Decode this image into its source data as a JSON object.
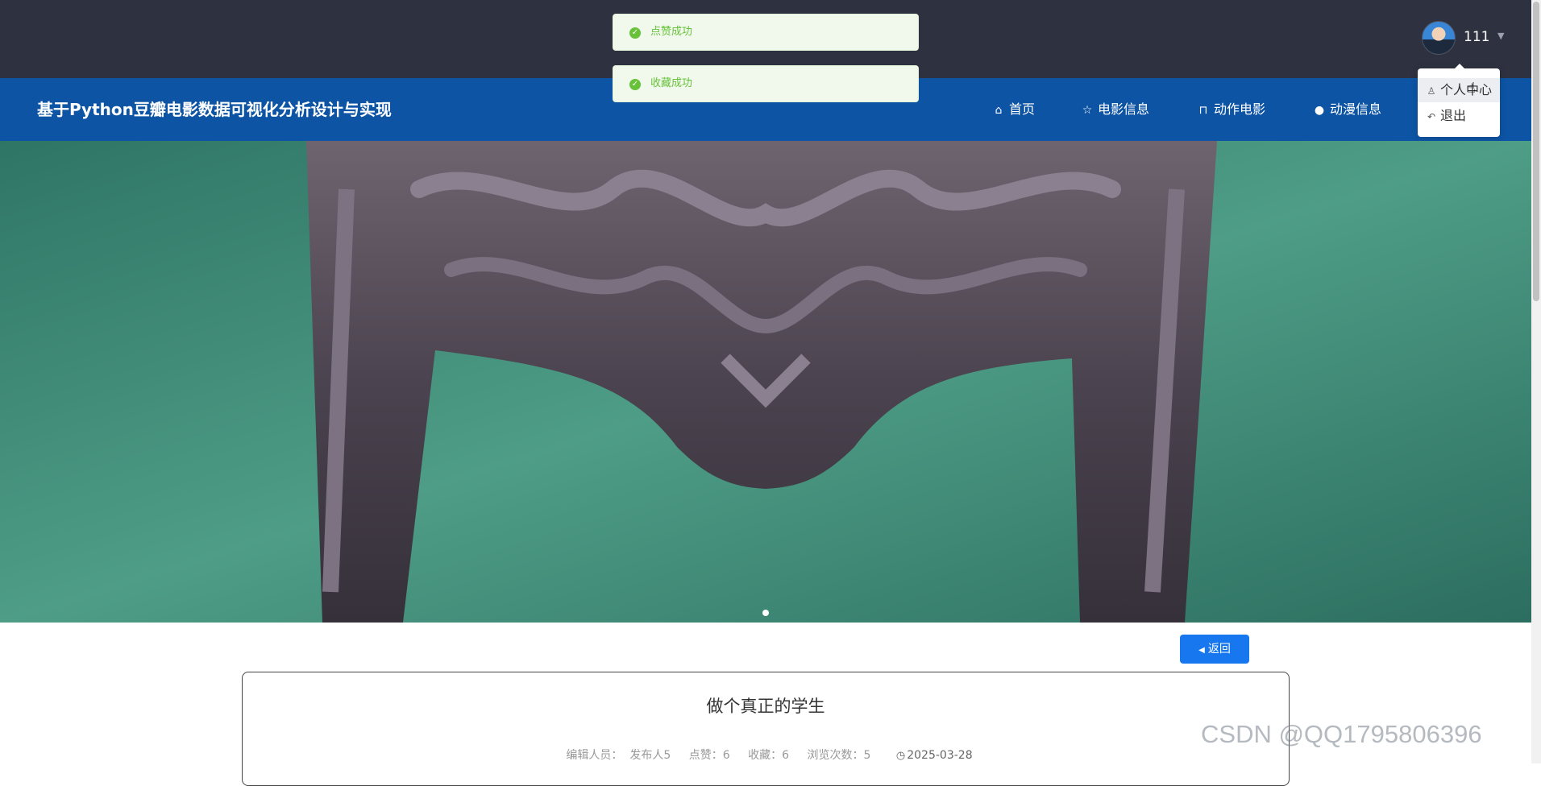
{
  "site": {
    "title": "基于Python豆瓣电影数据可视化分析设计与实现"
  },
  "nav": [
    {
      "label": "首页",
      "icon": "home-icon"
    },
    {
      "label": "电影信息",
      "icon": "star-icon"
    },
    {
      "label": "动作电影",
      "icon": "bag-icon"
    },
    {
      "label": "动漫信息",
      "icon": "info-icon"
    }
  ],
  "user": {
    "name": "111"
  },
  "dropdown": {
    "items": [
      {
        "label": "个人中心",
        "icon": "user-icon"
      },
      {
        "label": "退出",
        "icon": "logout-icon"
      }
    ]
  },
  "toasts": [
    {
      "message": "点赞成功"
    },
    {
      "message": "收藏成功"
    }
  ],
  "back_button": {
    "label": "返回"
  },
  "article": {
    "title": "做个真正的学生",
    "editor_label": "编辑人员：",
    "editor": "发布人5",
    "likes_label": "点赞：",
    "likes": "6",
    "favorites_label": "收藏：",
    "favorites": "6",
    "views_label": "浏览次数：",
    "views": "5",
    "date": "2025-03-28"
  },
  "watermark": "CSDN @QQ1795806396",
  "colors": {
    "topbar": "#2e3240",
    "navbar": "#0d54a5",
    "primary_button": "#1677ee",
    "success": "#67c23a"
  }
}
